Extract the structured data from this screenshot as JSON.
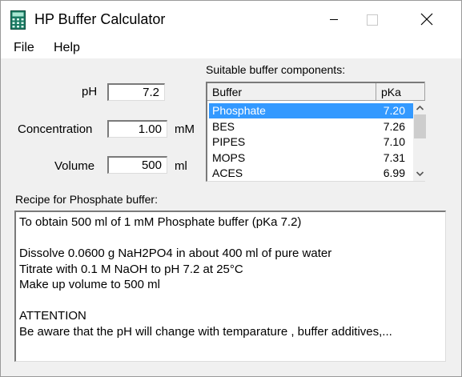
{
  "window": {
    "title": "HP Buffer Calculator",
    "icon": "calculator-icon",
    "controls": [
      "minimize-icon",
      "maximize-icon",
      "close-icon"
    ]
  },
  "menu": {
    "items": [
      "File",
      "Help"
    ]
  },
  "inputs": {
    "ph": {
      "label": "pH",
      "value": "7.2"
    },
    "concentration": {
      "label": "Concentration",
      "value": "1.00",
      "unit": "mM"
    },
    "volume": {
      "label": "Volume",
      "value": "500",
      "unit": "ml"
    }
  },
  "buffers": {
    "label": "Suitable buffer components:",
    "columns": [
      "Buffer",
      "pKa"
    ],
    "rows": [
      {
        "name": "Phosphate",
        "pka": "7.20",
        "selected": true
      },
      {
        "name": "BES",
        "pka": "7.26"
      },
      {
        "name": "PIPES",
        "pka": "7.10"
      },
      {
        "name": "MOPS",
        "pka": "7.31"
      },
      {
        "name": "ACES",
        "pka": "6.99"
      }
    ],
    "selection_color": "#3399ff"
  },
  "recipe": {
    "label": "Recipe for Phosphate buffer:",
    "lines": [
      "To obtain 500 ml of 1 mM Phosphate buffer (pKa 7.2)",
      "",
      "Dissolve 0.0600 g NaH2PO4 in about 400 ml of pure water",
      "Titrate with 0.1 M NaOH to pH 7.2 at 25°C",
      "Make up volume to 500 ml",
      "",
      "ATTENTION",
      "Be aware that the pH will change with temparature , buffer additives,..."
    ]
  }
}
